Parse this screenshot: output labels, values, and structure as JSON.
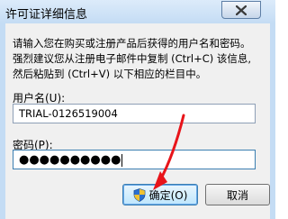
{
  "window": {
    "title": "许可证详细信息"
  },
  "instructions": [
    "请输入您在购买或注册产品后获得的用户名和密码。",
    "强烈建议您从注册电子邮件中复制 (Ctrl+C) 该信息,",
    "然后粘贴到 (Ctrl+V) 以下相应的栏目中。"
  ],
  "username": {
    "label": "用户名(U):",
    "value": "TRIAL-0126519004"
  },
  "password": {
    "label": "密码(P):",
    "masked": "●●●●●●●●●●"
  },
  "buttons": {
    "ok": "确定(O)",
    "cancel": "取消"
  },
  "colors": {
    "annotation_arrow": "#e8141a",
    "shield_blue": "#2b6fd0",
    "shield_yellow": "#f1c232"
  }
}
